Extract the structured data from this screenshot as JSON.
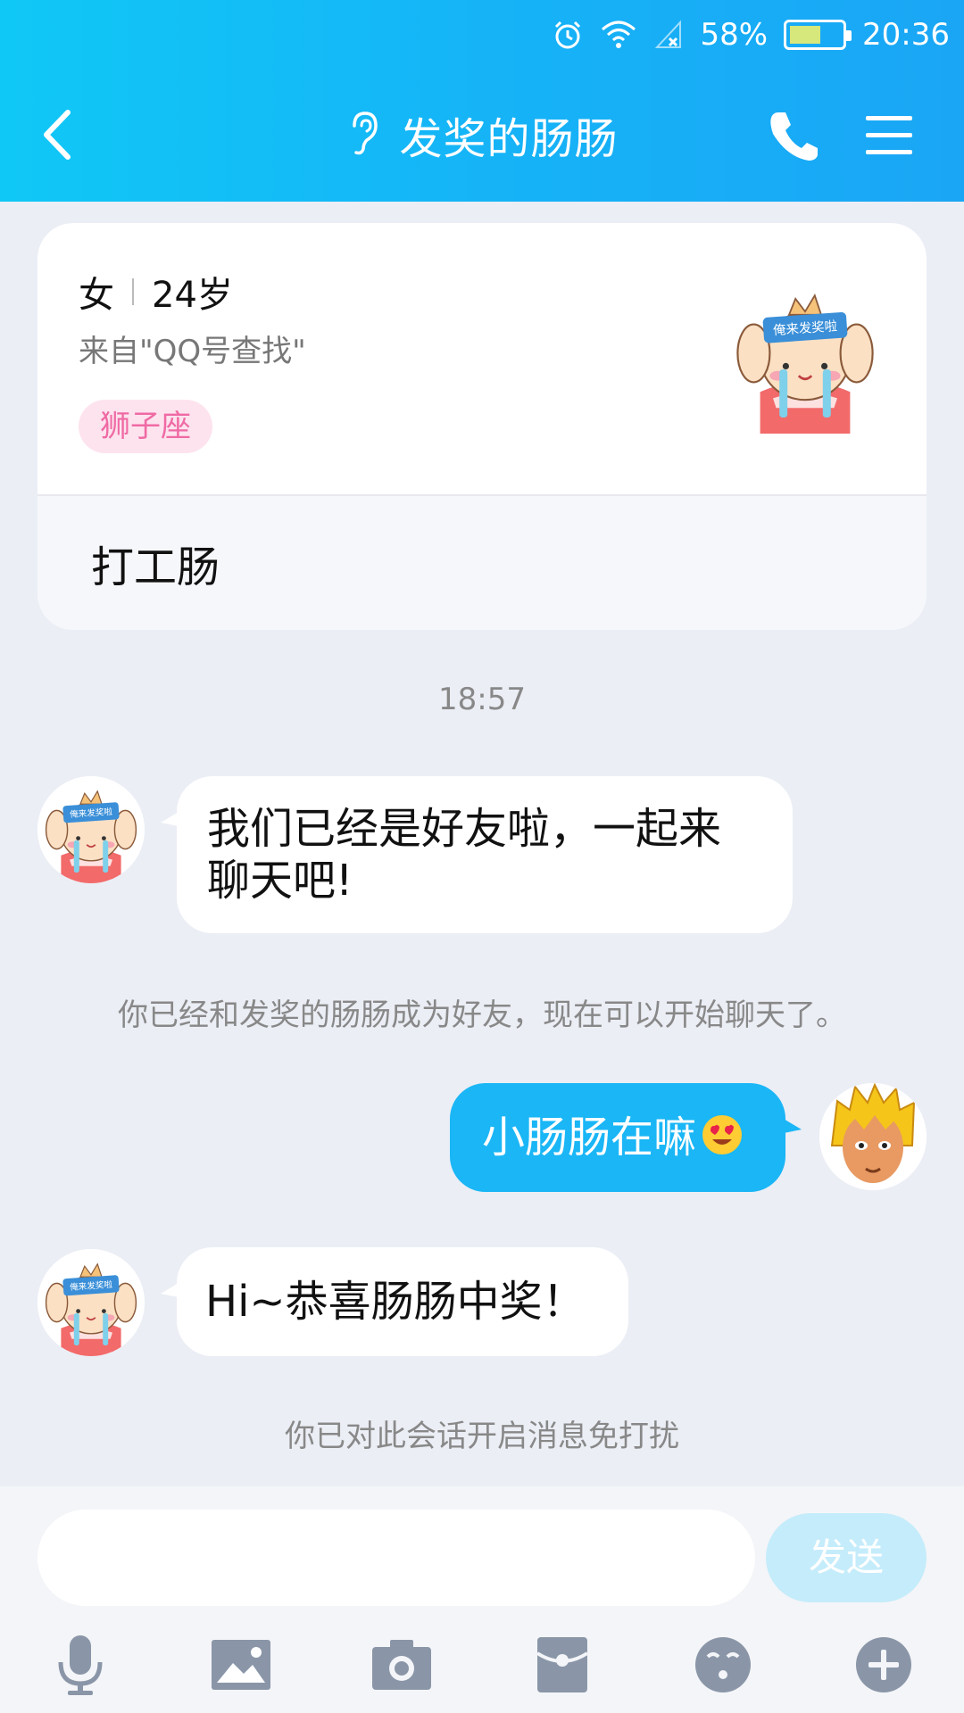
{
  "status_bar": {
    "battery_percent": "58%",
    "time": "20:36",
    "icons": [
      "alarm-icon",
      "wifi-icon",
      "signal-icon",
      "battery-icon"
    ]
  },
  "header": {
    "title": "发奖的肠肠",
    "icons": [
      "back-icon",
      "ear-icon",
      "phone-icon",
      "menu-icon"
    ]
  },
  "profile": {
    "gender": "女",
    "age": "24岁",
    "source": "来自\"QQ号查找\"",
    "tag": "狮子座",
    "signature": "打工肠",
    "avatar_badge": "俺来发奖啦"
  },
  "chat": {
    "timestamp": "18:57",
    "messages": [
      {
        "text": "我们已经是好友啦，一起来聊天吧!",
        "line1": "我们已经是好友啦，一起来",
        "line2": "聊天吧!"
      },
      {
        "text": "小肠肠在嘛"
      },
      {
        "text": "Hi~恭喜肠肠中奖！"
      }
    ],
    "system_notes": [
      "你已经和发奖的肠肠成为好友，现在可以开始聊天了。",
      "你已对此会话开启消息免打扰"
    ]
  },
  "input": {
    "placeholder": "",
    "send_label": "发送"
  },
  "toolbar": {
    "icons": [
      "microphone-icon",
      "image-icon",
      "camera-icon",
      "red-packet-icon",
      "emoji-icon",
      "plus-icon"
    ]
  },
  "colors": {
    "header_blue": "#16b2f7",
    "bubble_out": "#1ab6f6",
    "tag_bg": "#fde3ee",
    "tag_text": "#ef6aa4",
    "send_disabled": "#c5ecfb"
  }
}
